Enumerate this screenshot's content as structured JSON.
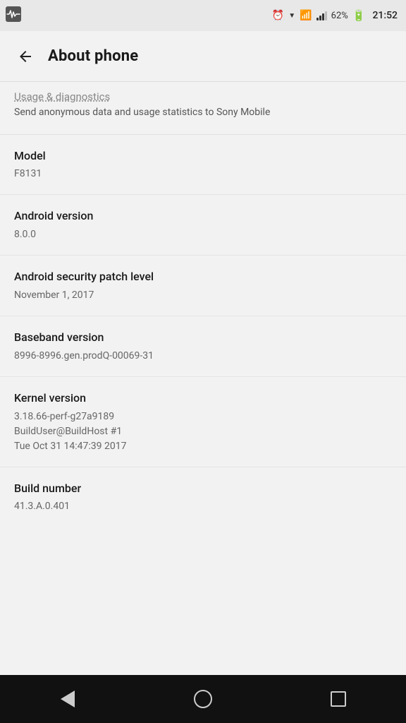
{
  "statusBar": {
    "time": "21:52",
    "battery": "62%",
    "icons": [
      "alarm",
      "wifi",
      "signal",
      "battery"
    ]
  },
  "appBar": {
    "title": "About phone",
    "backLabel": "back"
  },
  "partialItem": {
    "label": "Usage & diagnostics",
    "value": "Send anonymous data and usage statistics to Sony Mobile"
  },
  "items": [
    {
      "label": "Model",
      "value": "F8131"
    },
    {
      "label": "Android version",
      "value": "8.0.0"
    },
    {
      "label": "Android security patch level",
      "value": "November 1, 2017"
    },
    {
      "label": "Baseband version",
      "value": "8996-8996.gen.prodQ-00069-31"
    },
    {
      "label": "Kernel version",
      "value": "3.18.66-perf-g27a9189\nBuildUser@BuildHost #1\nTue Oct 31 14:47:39 2017"
    },
    {
      "label": "Build number",
      "value": "41.3.A.0.401"
    }
  ],
  "navBar": {
    "back": "back",
    "home": "home",
    "recents": "recents"
  }
}
